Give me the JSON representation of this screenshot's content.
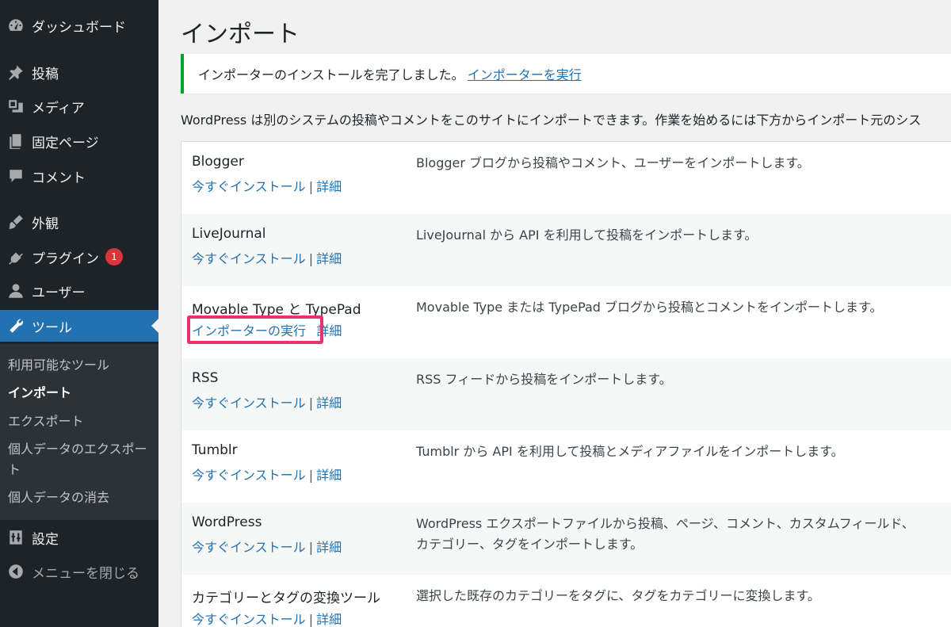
{
  "sidebar": {
    "menu": [
      {
        "label": "ダッシュボード",
        "icon": "dashboard-icon"
      },
      {
        "label": "投稿",
        "icon": "pin-icon"
      },
      {
        "label": "メディア",
        "icon": "media-icon"
      },
      {
        "label": "固定ページ",
        "icon": "page-icon"
      },
      {
        "label": "コメント",
        "icon": "comment-icon"
      },
      {
        "label": "外観",
        "icon": "brush-icon"
      },
      {
        "label": "プラグイン",
        "icon": "plugin-icon",
        "badge": "1"
      },
      {
        "label": "ユーザー",
        "icon": "user-icon"
      },
      {
        "label": "ツール",
        "icon": "wrench-icon"
      },
      {
        "label": "設定",
        "icon": "settings-icon"
      },
      {
        "label": "メニューを閉じる",
        "icon": "collapse-icon"
      }
    ],
    "submenu": [
      {
        "label": "利用可能なツール"
      },
      {
        "label": "インポート"
      },
      {
        "label": "エクスポート"
      },
      {
        "label": "個人データのエクスポート"
      },
      {
        "label": "個人データの消去"
      }
    ]
  },
  "main": {
    "title": "インポート",
    "notice": {
      "text": "インポーターのインストールを完了しました。",
      "link": "インポーターを実行"
    },
    "intro": "WordPress は別のシステムの投稿やコメントをこのサイトにインポートできます。作業を始めるには下方からインポート元のシス",
    "importers": [
      {
        "name": "Blogger",
        "action": "今すぐインストール",
        "details": "詳細",
        "desc": "Blogger ブログから投稿やコメント、ユーザーをインポートします。"
      },
      {
        "name": "LiveJournal",
        "action": "今すぐインストール",
        "details": "詳細",
        "desc": "LiveJournal から API を利用して投稿をインポートします。"
      },
      {
        "name": "Movable Type と TypePad",
        "action": "インポーターの実行",
        "details": "詳細",
        "desc": "Movable Type または TypePad ブログから投稿とコメントをインポートします。"
      },
      {
        "name": "RSS",
        "action": "今すぐインストール",
        "details": "詳細",
        "desc": "RSS フィードから投稿をインポートします。"
      },
      {
        "name": "Tumblr",
        "action": "今すぐインストール",
        "details": "詳細",
        "desc": "Tumblr から API を利用して投稿とメディアファイルをインポートします。"
      },
      {
        "name": "WordPress",
        "action": "今すぐインストール",
        "details": "詳細",
        "desc": "WordPress エクスポートファイルから投稿、ページ、コメント、カスタムフィールド、カテゴリー、タグをインポートします。"
      },
      {
        "name": "カテゴリーとタグの変換ツール",
        "action": "今すぐインストール",
        "details": "詳細",
        "desc": "選択した既存のカテゴリーをタグに、タグをカテゴリーに変換します。"
      }
    ]
  }
}
